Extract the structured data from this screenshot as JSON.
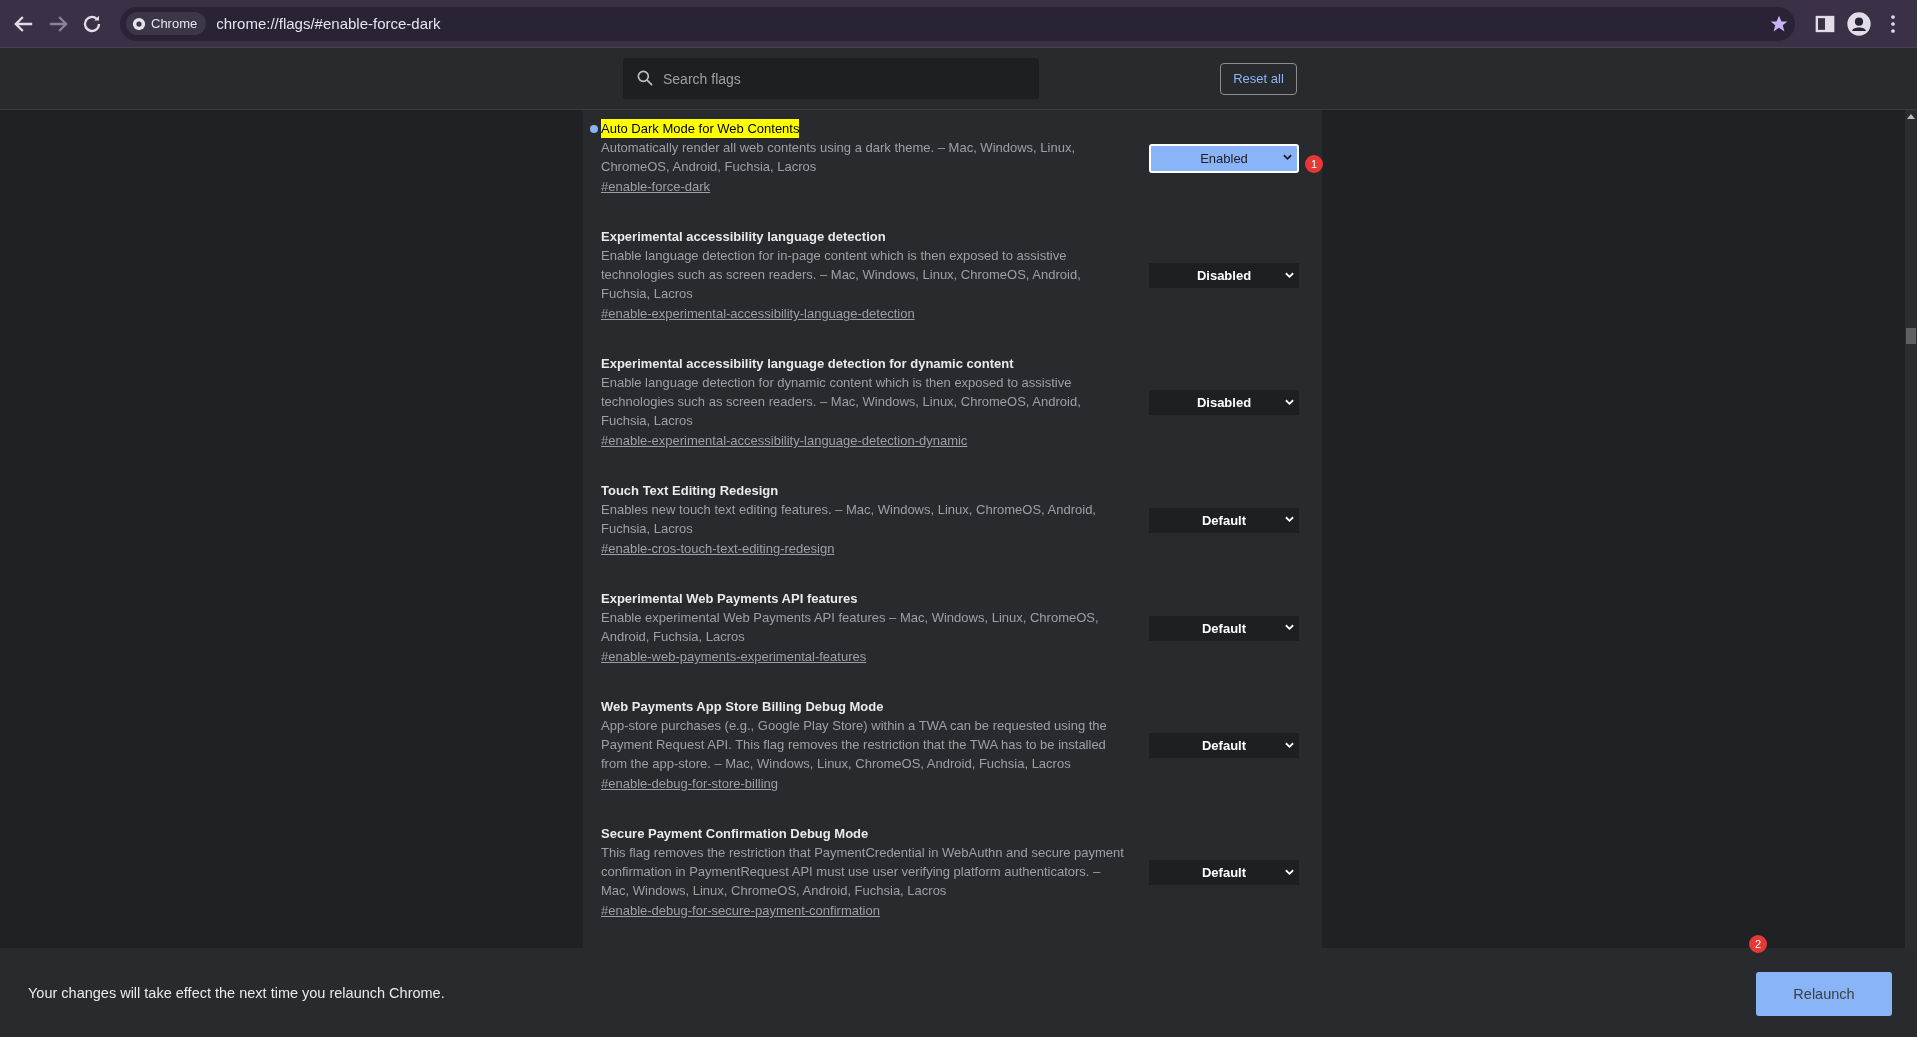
{
  "browser": {
    "chip": "Chrome",
    "url": "chrome://flags/#enable-force-dark"
  },
  "header": {
    "search": {
      "placeholder": "Search flags"
    },
    "reset_button": "Reset all"
  },
  "flags": [
    {
      "title": "Auto Dark Mode for Web Contents",
      "description": "Automatically render all web contents using a dark theme. – Mac, Windows, Linux, ChromeOS, Android, Fuchsia, Lacros",
      "link": "#enable-force-dark",
      "value": "Enabled",
      "modified": true,
      "highlighted": true
    },
    {
      "title": "Experimental accessibility language detection",
      "description": "Enable language detection for in-page content which is then exposed to assistive technologies such as screen readers. – Mac, Windows, Linux, ChromeOS, Android, Fuchsia, Lacros",
      "link": "#enable-experimental-accessibility-language-detection",
      "value": "Disabled",
      "modified": false,
      "highlighted": false
    },
    {
      "title": "Experimental accessibility language detection for dynamic content",
      "description": "Enable language detection for dynamic content which is then exposed to assistive technologies such as screen readers. – Mac, Windows, Linux, ChromeOS, Android, Fuchsia, Lacros",
      "link": "#enable-experimental-accessibility-language-detection-dynamic",
      "value": "Disabled",
      "modified": false,
      "highlighted": false
    },
    {
      "title": "Touch Text Editing Redesign",
      "description": "Enables new touch text editing features. – Mac, Windows, Linux, ChromeOS, Android, Fuchsia, Lacros",
      "link": "#enable-cros-touch-text-editing-redesign",
      "value": "Default",
      "modified": false,
      "highlighted": false
    },
    {
      "title": "Experimental Web Payments API features",
      "description": "Enable experimental Web Payments API features – Mac, Windows, Linux, ChromeOS, Android, Fuchsia, Lacros",
      "link": "#enable-web-payments-experimental-features",
      "value": "Default",
      "modified": false,
      "highlighted": false
    },
    {
      "title": "Web Payments App Store Billing Debug Mode",
      "description": "App-store purchases (e.g., Google Play Store) within a TWA can be requested using the Payment Request API. This flag removes the restriction that the TWA has to be installed from the app-store. – Mac, Windows, Linux, ChromeOS, Android, Fuchsia, Lacros",
      "link": "#enable-debug-for-store-billing",
      "value": "Default",
      "modified": false,
      "highlighted": false
    },
    {
      "title": "Secure Payment Confirmation Debug Mode",
      "description": "This flag removes the restriction that PaymentCredential in WebAuthn and secure payment confirmation in PaymentRequest API must use user verifying platform authenticators. – Mac, Windows, Linux, ChromeOS, Android, Fuchsia, Lacros",
      "link": "#enable-debug-for-secure-payment-confirmation",
      "value": "Default",
      "modified": false,
      "highlighted": false
    }
  ],
  "relaunch_bar": {
    "message": "Your changes will take effect the next time you relaunch Chrome.",
    "button": "Relaunch"
  },
  "annotations": [
    "1",
    "2"
  ]
}
